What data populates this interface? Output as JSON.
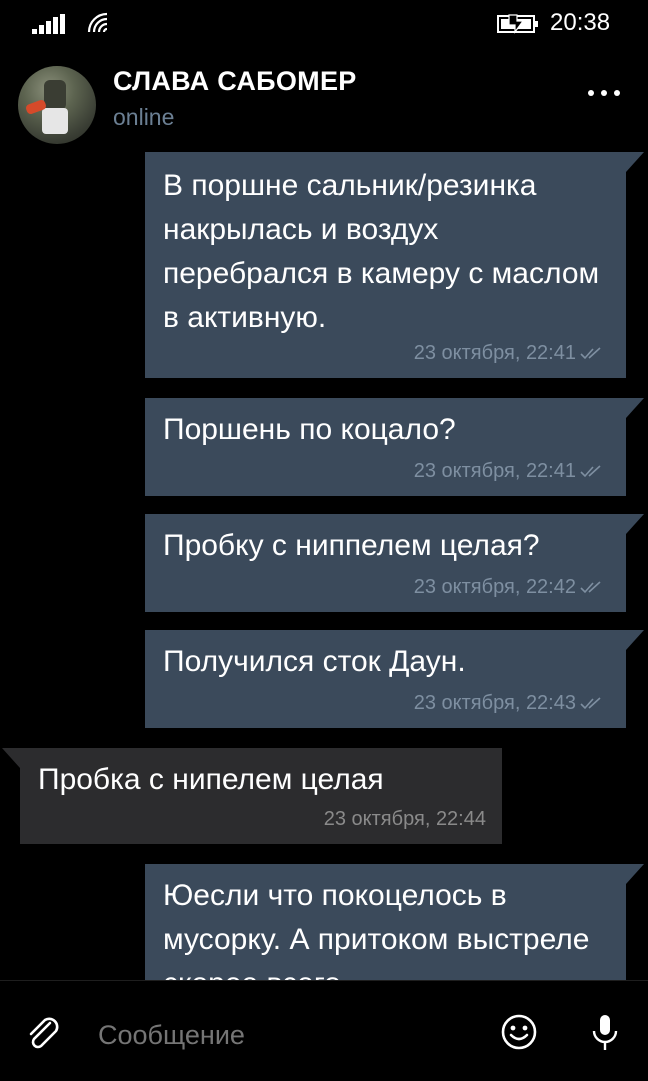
{
  "status_bar": {
    "time": "20:38"
  },
  "header": {
    "name": "СЛАВА САБОМЕР",
    "status": "online"
  },
  "messages": [
    {
      "direction": "out",
      "text": "В поршне сальник/резинка накрылась и воздух перебрался в камеру с маслом в активную.",
      "time": "23 октября, 22:41",
      "read": true
    },
    {
      "direction": "out",
      "text": "Поршень по коцало?",
      "time": "23 октября, 22:41",
      "read": true
    },
    {
      "direction": "out",
      "text": "Пробку с ниппелем целая?",
      "time": "23 октября, 22:42",
      "read": true
    },
    {
      "direction": "out",
      "text": "Получился сток Даун.",
      "time": "23 октября, 22:43",
      "read": true
    },
    {
      "direction": "in",
      "text": "Пробка с нипелем целая",
      "time": "23 октября, 22:44"
    },
    {
      "direction": "out",
      "text": "Юесли что покоцелось в мусорку. А притоком выстреле скорее всего",
      "time": ""
    }
  ],
  "composer": {
    "placeholder": "Сообщение"
  },
  "icons": {
    "signal": "signal-bars-icon",
    "wifi": "wifi-icon",
    "battery": "battery-charging-icon",
    "menu": "more-dots-icon",
    "attach": "paperclip-icon",
    "emoji": "emoji-smile-icon",
    "mic": "microphone-icon"
  },
  "colors": {
    "outgoing_bubble": "#3b4a5b",
    "incoming_bubble": "#2c2c2e",
    "timestamp": "#7e8fa1"
  }
}
